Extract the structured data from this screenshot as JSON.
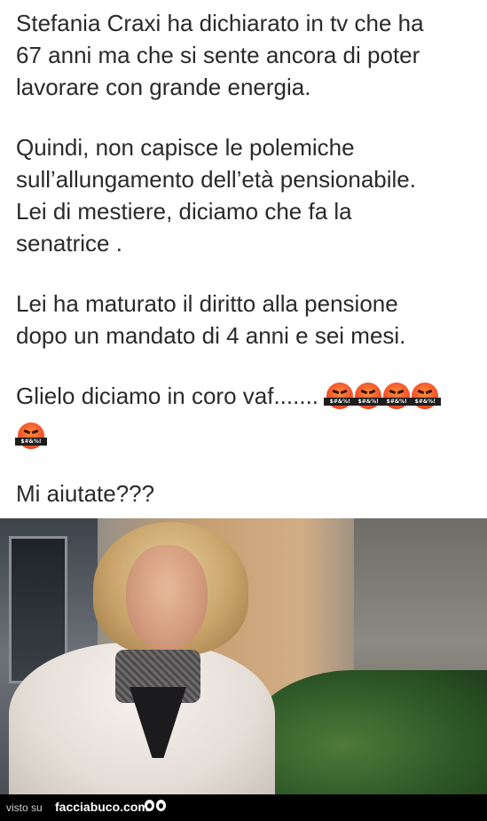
{
  "post": {
    "paragraph1": [
      "Stefania Craxi ha dichiarato in tv  che ha",
      "67 anni ma che si sente ancora di poter",
      "lavorare con grande energia."
    ],
    "paragraph2": [
      "Quindi, non capisce le polemiche",
      "sull’allungamento dell’età pensionabile.",
      "Lei di mestiere, diciamo che fa la",
      "senatrice ."
    ],
    "paragraph3": [
      "Lei ha maturato  il diritto alla pensione",
      "dopo un mandato di 4 anni e sei mesi."
    ],
    "paragraph4": "Glielo diciamo in coro vaf.......",
    "emoji_label": "$#&%!",
    "emoji_name": "face-with-symbols-on-mouth-icon",
    "emoji_count": 5,
    "paragraph5": "Mi aiutate???"
  },
  "footer": {
    "visto_su": "visto su",
    "brand": "facciabuco.com"
  }
}
